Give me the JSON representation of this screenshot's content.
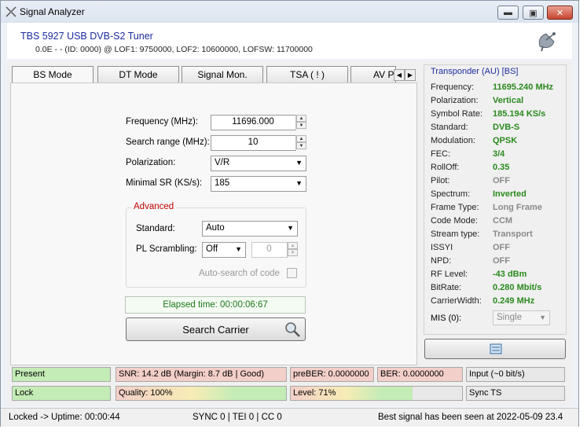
{
  "window": {
    "title": "Signal Analyzer"
  },
  "header": {
    "product": "TBS 5927 USB DVB-S2 Tuner",
    "device_info": "0.0E - - (ID: 0000) @ LOF1: 9750000, LOF2: 10600000, LOFSW: 11700000"
  },
  "tabs": [
    "BS Mode",
    "DT Mode",
    "Signal Mon.",
    "TSA ( ! )",
    "AV P"
  ],
  "form": {
    "frequency_label": "Frequency (MHz):",
    "frequency_value": "11696.000",
    "search_range_label": "Search range (MHz):",
    "search_range_value": "10",
    "polarization_label": "Polarization:",
    "polarization_value": "V/R",
    "minsr_label": "Minimal SR (KS/s):",
    "minsr_value": "185"
  },
  "advanced": {
    "title": "Advanced",
    "standard_label": "Standard:",
    "standard_value": "Auto",
    "pls_label": "PL Scrambling:",
    "pls_value": "Off",
    "pls_code": "0",
    "autosearch_label": "Auto-search of code"
  },
  "elapsed": "Elapsed time: 00:00:06:67",
  "search_button": "Search Carrier",
  "transponder": {
    "title": "Transponder (AU) [BS]",
    "rows": [
      {
        "k": "Frequency:",
        "v": "11695.240 MHz",
        "c": "green"
      },
      {
        "k": "Polarization:",
        "v": "Vertical",
        "c": "green"
      },
      {
        "k": "Symbol Rate:",
        "v": "185.194 KS/s",
        "c": "green"
      },
      {
        "k": "Standard:",
        "v": "DVB-S",
        "c": "green"
      },
      {
        "k": "Modulation:",
        "v": "QPSK",
        "c": "green"
      },
      {
        "k": "FEC:",
        "v": "3/4",
        "c": "green"
      },
      {
        "k": "RollOff:",
        "v": "0.35",
        "c": "green"
      },
      {
        "k": "Pilot:",
        "v": "OFF",
        "c": "gray"
      },
      {
        "k": "Spectrum:",
        "v": "Inverted",
        "c": "green"
      },
      {
        "k": "Frame Type:",
        "v": "Long Frame",
        "c": "gray"
      },
      {
        "k": "Code Mode:",
        "v": "CCM",
        "c": "gray"
      },
      {
        "k": "Stream type:",
        "v": "Transport",
        "c": "gray"
      },
      {
        "k": "ISSYI",
        "v": "OFF",
        "c": "gray"
      },
      {
        "k": "NPD:",
        "v": "OFF",
        "c": "gray"
      },
      {
        "k": "RF Level:",
        "v": "-43 dBm",
        "c": "green"
      },
      {
        "k": "BitRate:",
        "v": "0.280 Mbit/s",
        "c": "green"
      },
      {
        "k": "CarrierWidth:",
        "v": "0.249 MHz",
        "c": "green"
      }
    ],
    "mis_label": "MIS (0):",
    "mis_value": "Single"
  },
  "status": {
    "present": "Present",
    "snr": "SNR: 14.2 dB (Margin: 8.7 dB | Good)",
    "preber": "preBER: 0.0000000",
    "ber": "BER: 0.0000000",
    "input": "Input (~0 bit/s)",
    "lock": "Lock",
    "quality": "Quality: 100%",
    "quality_fraction": 1.0,
    "level": "Level: 71%",
    "level_fraction": 0.71,
    "sync": "Sync TS"
  },
  "statusbar": {
    "uptime": "Locked -> Uptime: 00:00:44",
    "counters": "SYNC 0 | TEI 0 | CC 0",
    "best": "Best signal has been seen at 2022-05-09 23.4"
  },
  "colors": {
    "good": "#2a8a1e",
    "accent": "#1a2c9e",
    "bar_green": "#b8e6a8",
    "bar_red": "#f2c9c4"
  }
}
